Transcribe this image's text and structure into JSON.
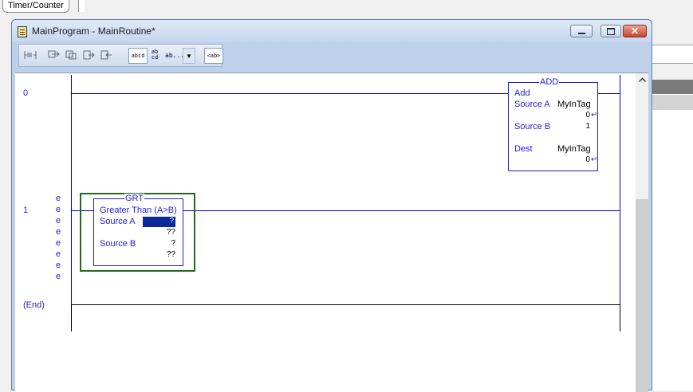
{
  "top_tab": {
    "label": "Timer/Counter"
  },
  "window": {
    "title": "MainProgram - MainRoutine*",
    "controls": {
      "close": "✕"
    }
  },
  "toolbar": {
    "abcd": "abcd",
    "ab_cd_top": "ab",
    "ab_cd_bottom": "cd",
    "ab_dots": "ab...",
    "dropdown": "▼",
    "ab_tag": "<ab>"
  },
  "rungs": [
    {
      "number": "0",
      "instruction": {
        "mnemonic": "ADD",
        "name": "Add",
        "source_a_label": "Source A",
        "source_a_tag": "MyInTag",
        "source_a_value": "0",
        "source_b_label": "Source B",
        "source_b_value": "1",
        "dest_label": "Dest",
        "dest_tag": "MyInTag",
        "dest_value": "0"
      }
    },
    {
      "number": "1",
      "error_markers": [
        "e",
        "e",
        "e",
        "e",
        "e",
        "e",
        "e",
        "e"
      ],
      "instruction": {
        "mnemonic": "GRT",
        "name": "Greater Than (A>B)",
        "source_a_label": "Source A",
        "source_a_tag": "?",
        "source_a_value": "??",
        "source_b_label": "Source B",
        "source_b_tag": "?",
        "source_b_value": "??"
      }
    }
  ],
  "end_label": "(End)",
  "scroll_icon": "up-arrow",
  "colors": {
    "ladder_blue": "#1f1fd0",
    "selection_box": "#0a2a9c",
    "grt_border": "#1e6b1e"
  }
}
